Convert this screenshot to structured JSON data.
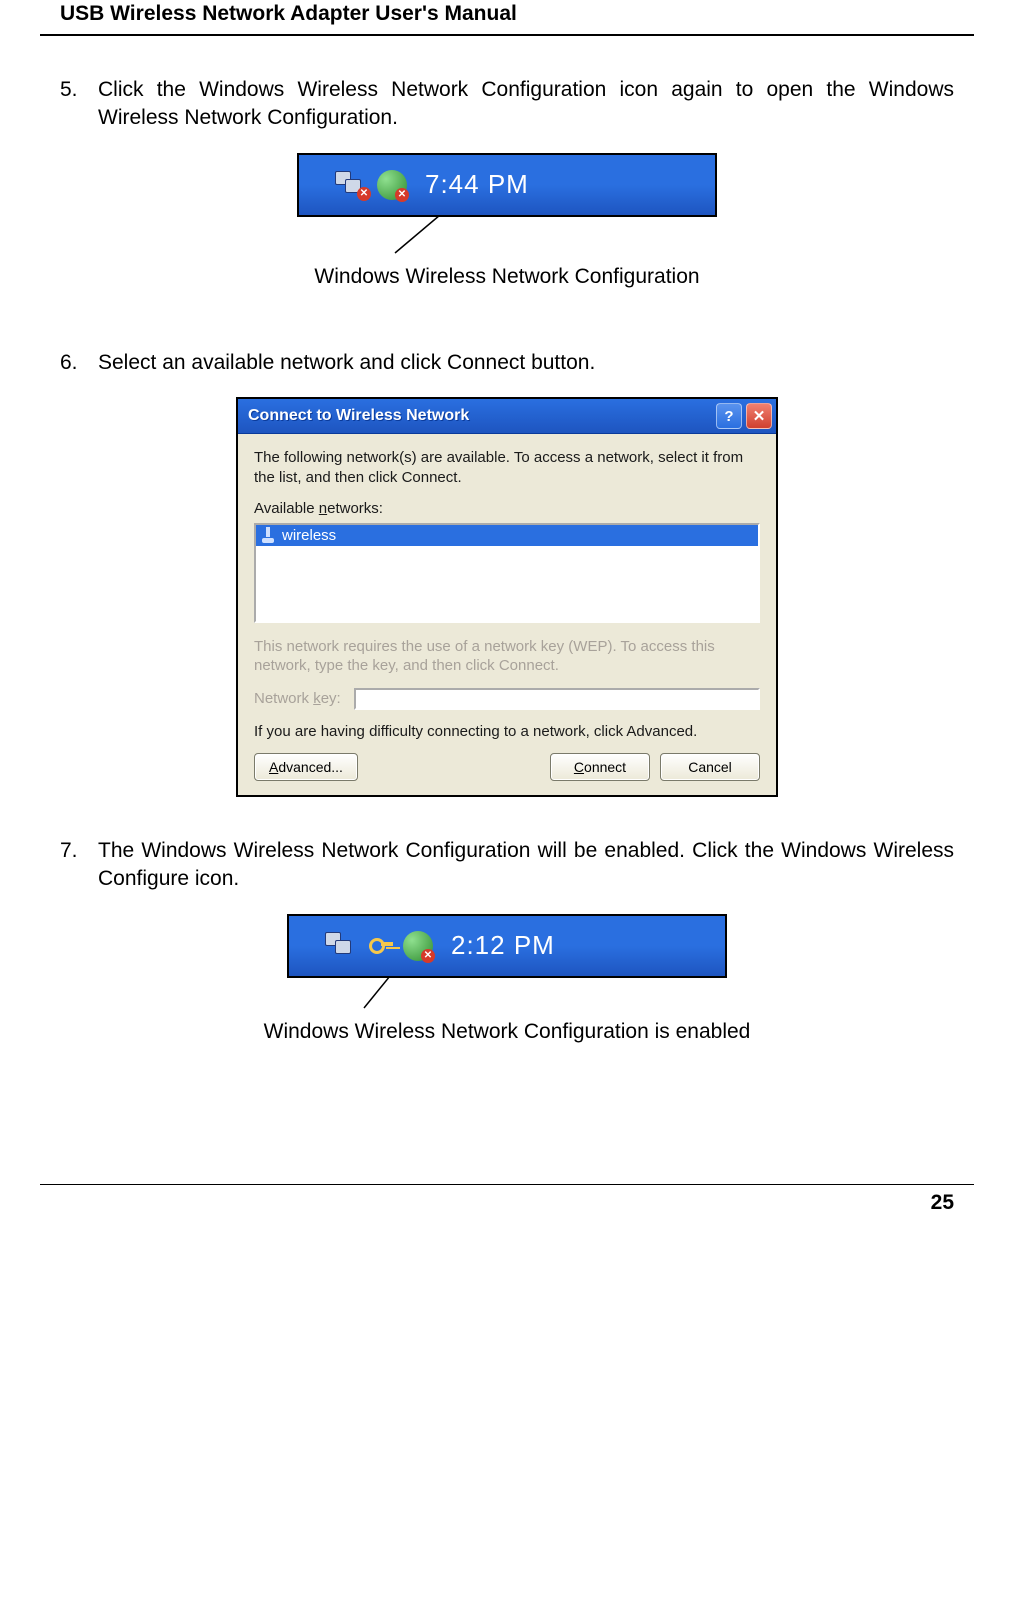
{
  "header": {
    "title": "USB Wireless Network Adapter User's Manual"
  },
  "steps": {
    "s5": {
      "num": "5.",
      "text": "Click the Windows Wireless Network Configuration icon again to open the Windows Wireless Network Configuration."
    },
    "s6": {
      "num": "6.",
      "text": "Select an available network and click Connect button."
    },
    "s7": {
      "num": "7.",
      "text": "The Windows Wireless Network Configuration will be enabled. Click the Windows Wireless Configure icon."
    }
  },
  "figure1": {
    "clock": "7:44 PM",
    "caption": "Windows Wireless Network Configuration"
  },
  "dialog": {
    "title": "Connect to Wireless Network",
    "help": "?",
    "close": "✕",
    "intro": "The following network(s) are available. To access a network, select it from the list, and then click Connect.",
    "available_label": "Available networks:",
    "networks": [
      "wireless"
    ],
    "wep_text": "This network requires the use of a network key (WEP). To access this network, type the key, and then click Connect.",
    "key_label": "Network key:",
    "key_value": "",
    "difficulty_text": "If you are having difficulty connecting to a network, click Advanced.",
    "buttons": {
      "advanced_u": "A",
      "advanced_rest": "dvanced...",
      "connect_u": "C",
      "connect_rest": "onnect",
      "cancel": "Cancel"
    }
  },
  "figure2": {
    "clock": "2:12 PM",
    "caption": "Windows Wireless Network Configuration is enabled"
  },
  "footer": {
    "page": "25"
  }
}
